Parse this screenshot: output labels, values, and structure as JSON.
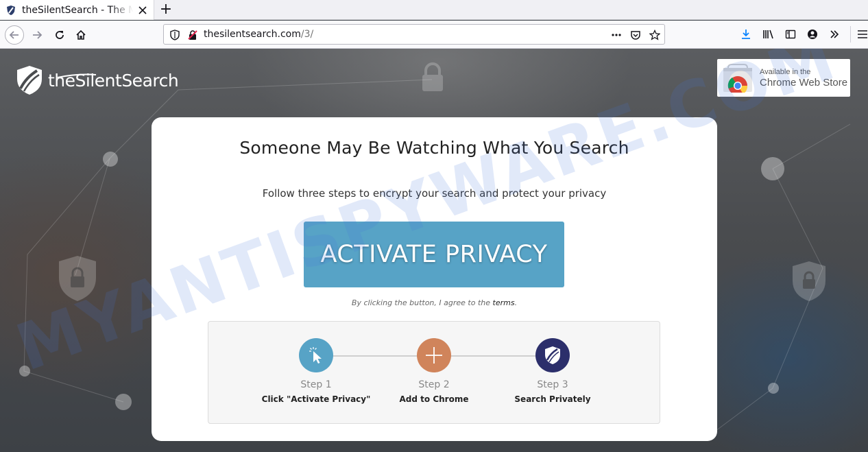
{
  "browser": {
    "tab_title": "theSilentSearch - The Mo",
    "new_tab_symbol": "+",
    "url_host": "thesilentsearch.com",
    "url_path": "/3/"
  },
  "page": {
    "logo_text": "theSilentSearch",
    "badge": {
      "small": "Available in the",
      "big": "Chrome Web Store"
    },
    "headline": "Someone May Be Watching What You Search",
    "subheadline": "Follow three steps to encrypt your search and protect your privacy",
    "cta_label": "ACTIVATE PRIVACY",
    "terms_prefix": "By clicking the button, I agree to the",
    "terms_link": "terms",
    "terms_suffix": ".",
    "steps": [
      {
        "label": "Step 1",
        "desc": "Click \"Activate Privacy\"",
        "color": "#57a3c6",
        "icon": "cursor-click-icon"
      },
      {
        "label": "Step 2",
        "desc": "Add to Chrome",
        "color": "#d0845b",
        "icon": "plus-icon"
      },
      {
        "label": "Step 3",
        "desc": "Search Privately",
        "color": "#2c2f6b",
        "icon": "shield-logo-icon"
      }
    ],
    "watermark": "MYANTISPYWARE.COM"
  }
}
